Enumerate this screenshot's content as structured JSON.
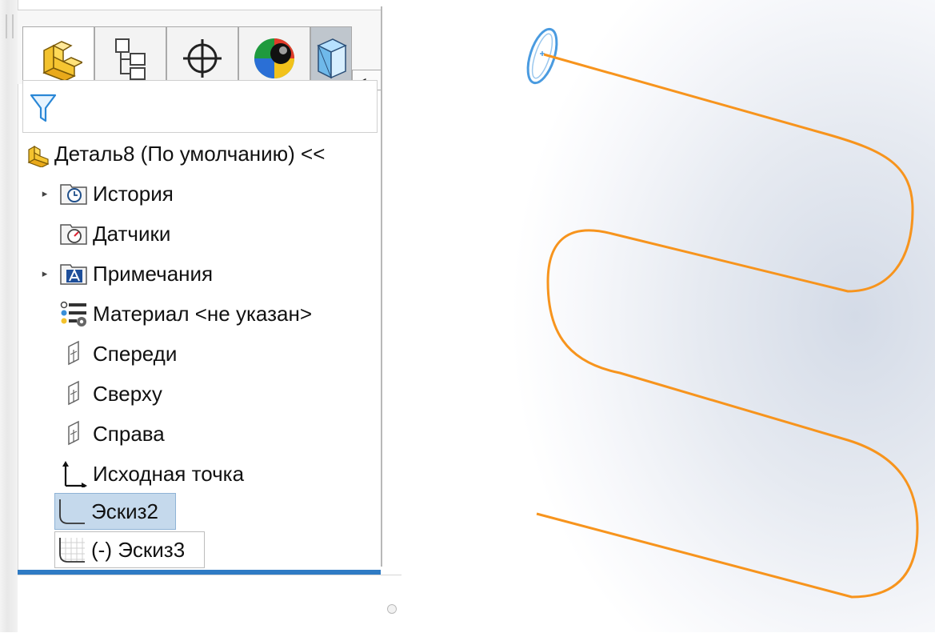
{
  "panel": {
    "tabs": [
      {
        "icon": "feature-manager-icon"
      },
      {
        "icon": "property-manager-icon"
      },
      {
        "icon": "configuration-manager-icon"
      },
      {
        "icon": "appearance-icon"
      },
      {
        "icon": "display-manager-icon"
      }
    ],
    "tab_scroll": {
      "left": "◂",
      "right": "▸"
    },
    "filter_icon": "filter-funnel-icon",
    "tree": {
      "root": "Деталь8 (По умолчанию) <<",
      "items": [
        {
          "label": "История",
          "icon": "history-folder-icon",
          "expandable": true
        },
        {
          "label": "Датчики",
          "icon": "sensors-folder-icon",
          "expandable": false
        },
        {
          "label": "Примечания",
          "icon": "annotations-folder-icon",
          "expandable": true
        },
        {
          "label": "Материал <не указан>",
          "icon": "material-icon",
          "expandable": false
        },
        {
          "label": "Спереди",
          "icon": "plane-icon",
          "expandable": false
        },
        {
          "label": "Сверху",
          "icon": "plane-icon",
          "expandable": false
        },
        {
          "label": "Справа",
          "icon": "plane-icon",
          "expandable": false
        },
        {
          "label": "Исходная точка",
          "icon": "origin-icon",
          "expandable": false
        },
        {
          "label": "Эскиз2",
          "icon": "sketch-icon",
          "selected": true
        },
        {
          "label": "(-) Эскиз3",
          "icon": "sketch-3d-icon",
          "hovered": true
        }
      ],
      "expander_glyph": "▸"
    }
  },
  "colors": {
    "selection_bg": "#c5d9ec",
    "divider": "#2f7bc4",
    "sketch_curve": "#f7941d",
    "profile_circle": "#4a9be0"
  }
}
